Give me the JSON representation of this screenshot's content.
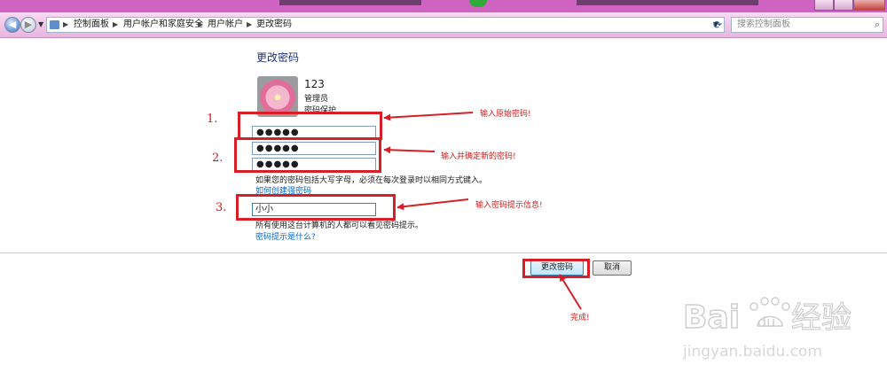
{
  "address": {
    "segments": [
      "控制面板",
      "用户帐户和家庭安全",
      "用户帐户",
      "更改密码"
    ]
  },
  "search": {
    "placeholder": "搜索控制面板"
  },
  "heading": "更改密码",
  "user": {
    "name": "123",
    "role": "管理员",
    "status": "密码保护"
  },
  "fields": {
    "current_password": "●●●●●",
    "new_password": "●●●●●",
    "confirm_password": "●●●●●",
    "password_hint": "小小"
  },
  "texts": {
    "caps_note": "如果您的密码包括大写字母，必须在每次登录时以相同方式键入。",
    "strong_link": "如何创建强密码",
    "hint_note": "所有使用这台计算机的人都可以看见密码提示。",
    "hint_link": "密码提示是什么?"
  },
  "buttons": {
    "change": "更改密码",
    "cancel": "取消"
  },
  "annotations": {
    "step1": "1.",
    "step2": "2.",
    "step3": "3.",
    "label1": "输入原始密码!",
    "label2": "输入并确定新的密码!",
    "label3": "输入密码提示信息!",
    "done": "完成!"
  },
  "watermark": {
    "logo": "Bai du 经验",
    "url": "jingyan.baidu.com"
  },
  "colors": {
    "annotation": "#d81e26",
    "link": "#0066cc",
    "heading": "#1e3287",
    "titlebar": "#cf63c2"
  }
}
